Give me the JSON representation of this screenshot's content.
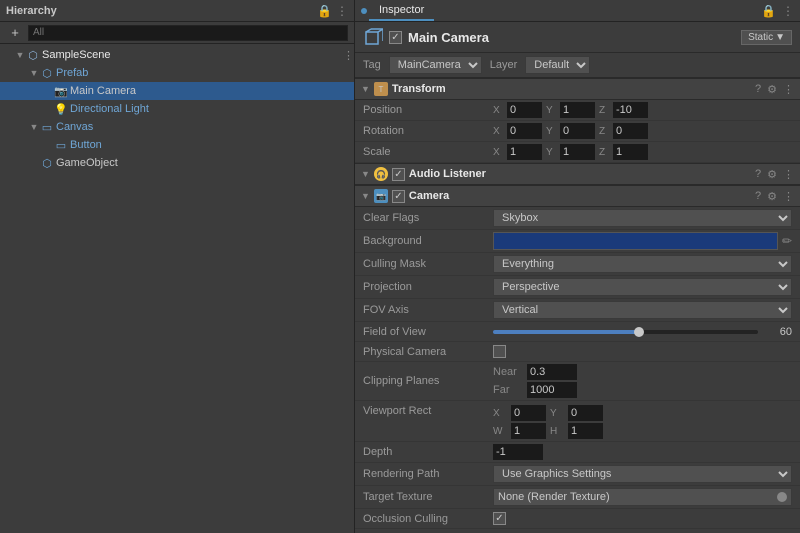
{
  "hierarchy": {
    "title": "Hierarchy",
    "search_placeholder": "All",
    "items": [
      {
        "id": "sample-scene",
        "label": "SampleScene",
        "depth": 0,
        "type": "scene",
        "arrow": "▼"
      },
      {
        "id": "prefab",
        "label": "Prefab",
        "depth": 1,
        "type": "prefab",
        "arrow": "▼"
      },
      {
        "id": "main-camera",
        "label": "Main Camera",
        "depth": 2,
        "type": "camera",
        "arrow": ""
      },
      {
        "id": "directional-light",
        "label": "Directional Light",
        "depth": 2,
        "type": "light",
        "arrow": ""
      },
      {
        "id": "canvas",
        "label": "Canvas",
        "depth": 1,
        "type": "canvas",
        "arrow": "▼"
      },
      {
        "id": "button",
        "label": "Button",
        "depth": 2,
        "type": "button",
        "arrow": ""
      },
      {
        "id": "gameobject",
        "label": "GameObject",
        "depth": 1,
        "type": "go",
        "arrow": ""
      }
    ]
  },
  "inspector": {
    "title": "Inspector",
    "object": {
      "name": "Main Camera",
      "enabled": true,
      "static_label": "Static",
      "tag_label": "Tag",
      "tag_value": "MainCamera",
      "layer_label": "Layer",
      "layer_value": "Default"
    },
    "components": {
      "transform": {
        "title": "Transform",
        "position": {
          "label": "Position",
          "x": "0",
          "y": "1",
          "z": "-10"
        },
        "rotation": {
          "label": "Rotation",
          "x": "0",
          "y": "0",
          "z": "0"
        },
        "scale": {
          "label": "Scale",
          "x": "1",
          "y": "1",
          "z": "1"
        }
      },
      "audio_listener": {
        "title": "Audio Listener",
        "enabled": true
      },
      "camera": {
        "title": "Camera",
        "enabled": true,
        "clear_flags_label": "Clear Flags",
        "clear_flags_value": "Skybox",
        "background_label": "Background",
        "culling_mask_label": "Culling Mask",
        "culling_mask_value": "Everything",
        "projection_label": "Projection",
        "projection_value": "Perspective",
        "fov_axis_label": "FOV Axis",
        "fov_axis_value": "Vertical",
        "field_of_view_label": "Field of View",
        "field_of_view_value": "60",
        "field_of_view_pct": 55,
        "physical_camera_label": "Physical Camera",
        "clipping_planes_label": "Clipping Planes",
        "near_label": "Near",
        "near_value": "0.3",
        "far_label": "Far",
        "far_value": "1000",
        "viewport_rect_label": "Viewport Rect",
        "vp_x": "0",
        "vp_y": "0",
        "vp_w": "1",
        "vp_h": "1",
        "depth_label": "Depth",
        "depth_value": "-1",
        "rendering_path_label": "Rendering Path",
        "rendering_path_value": "Use Graphics Settings",
        "target_texture_label": "Target Texture",
        "target_texture_value": "None (Render Texture)",
        "occlusion_culling_label": "Occlusion Culling"
      }
    }
  }
}
